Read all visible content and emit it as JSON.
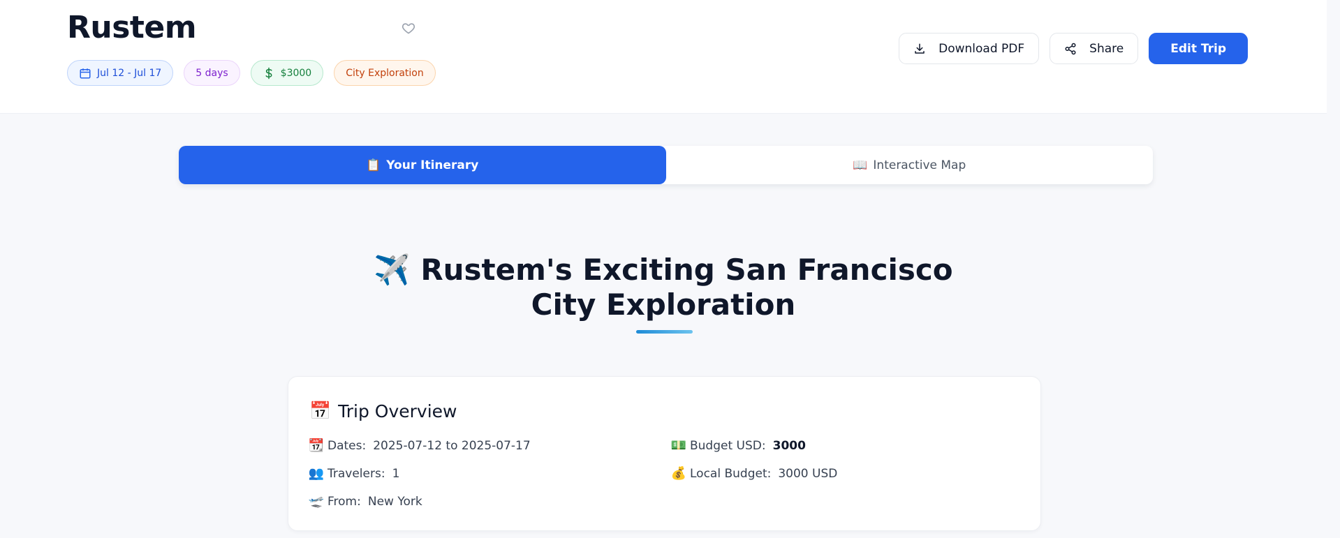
{
  "header": {
    "title": "Rustem",
    "chips": {
      "dates": "Jul 12 - Jul 17",
      "duration": "5 days",
      "budget": "$3000",
      "type": "City Exploration"
    },
    "actions": {
      "download": "Download PDF",
      "share": "Share",
      "edit": "Edit Trip"
    }
  },
  "tabs": {
    "itinerary": {
      "icon": "📋",
      "label": "Your Itinerary"
    },
    "map": {
      "icon": "📖",
      "label": "Interactive Map"
    }
  },
  "main": {
    "title_icon": "✈️",
    "title": "Rustem's Exciting San Francisco City Exploration"
  },
  "overview": {
    "icon": "📅",
    "title": "Trip Overview",
    "dates": {
      "icon": "📆",
      "label": "Dates:",
      "value": "2025-07-12 to 2025-07-17"
    },
    "travelers": {
      "icon": "👥",
      "label": "Travelers:",
      "value": "1"
    },
    "from": {
      "icon": "🛫",
      "label": "From:",
      "value": "New York"
    },
    "budget_usd": {
      "icon": "💵",
      "label": "Budget USD:",
      "value": "3000"
    },
    "local_budget": {
      "icon": "💰",
      "label": "Local Budget:",
      "value": "3000 USD"
    }
  },
  "colors": {
    "primary": "#2563eb",
    "text": "#0f172a",
    "background": "#f7f8fb"
  }
}
